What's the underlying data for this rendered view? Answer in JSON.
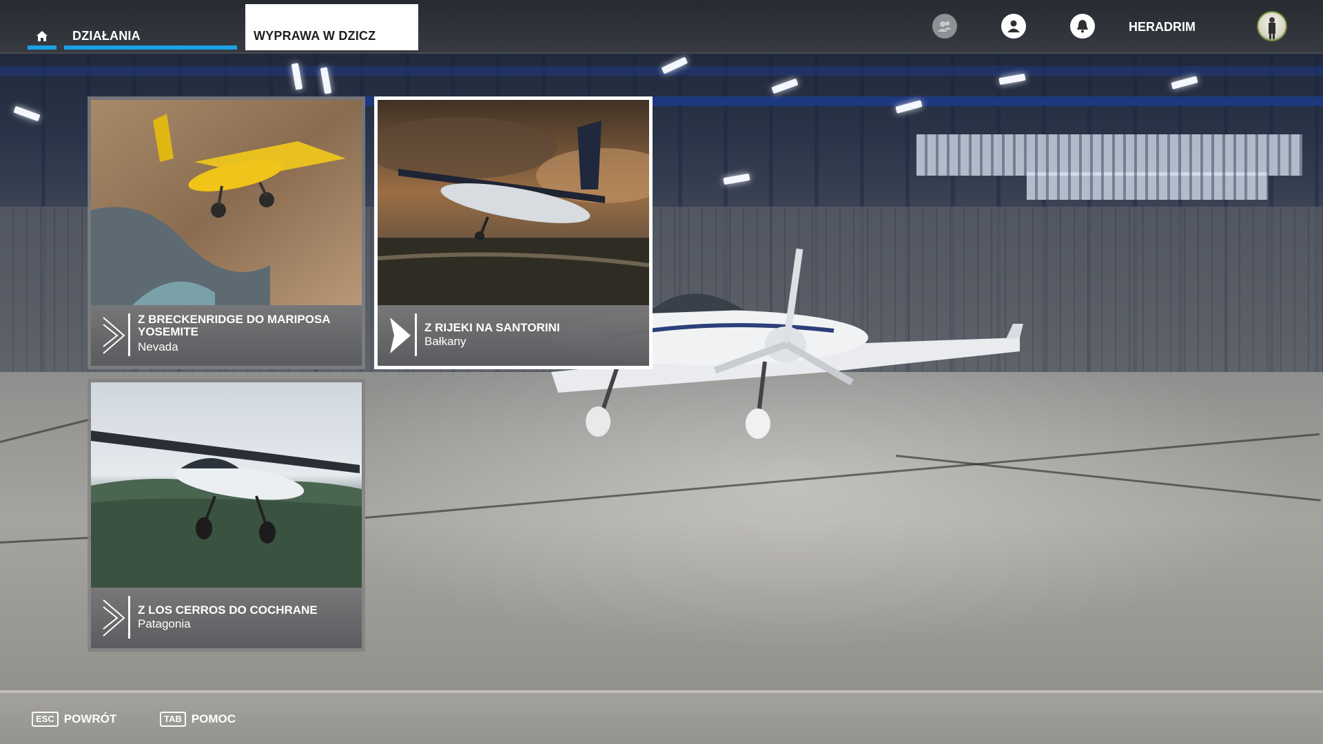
{
  "topbar": {
    "tabs": [
      {
        "label": "DZIAŁANIA",
        "state": "active"
      },
      {
        "label": "WYPRAWA W DZICZ",
        "state": "selected"
      }
    ],
    "icons": [
      "home-icon",
      "friends-icon",
      "profile-icon",
      "notifications-icon"
    ],
    "username": "HERADRIM"
  },
  "cards": [
    {
      "title": "Z BRECKENRIDGE DO MARIPOSA YOSEMITE",
      "subtitle": "Nevada",
      "image": "yellow-bush-plane-over-mountains"
    },
    {
      "title": "Z RIJEKI NA SANTORINI",
      "subtitle": "Bałkany",
      "image": "cessna-at-sunset-over-coast",
      "focused": true
    },
    {
      "title": "Z LOS CERROS DO COCHRANE",
      "subtitle": "Patagonia",
      "image": "white-bush-plane-over-forest"
    }
  ],
  "bottombar": {
    "hints": [
      {
        "key": "ESC",
        "label": "POWRÓT"
      },
      {
        "key": "TAB",
        "label": "POMOC"
      }
    ]
  },
  "colors": {
    "accent": "#1aa1e6",
    "selected_tab_bg": "#ffffff",
    "focus_border": "#ffffff"
  }
}
